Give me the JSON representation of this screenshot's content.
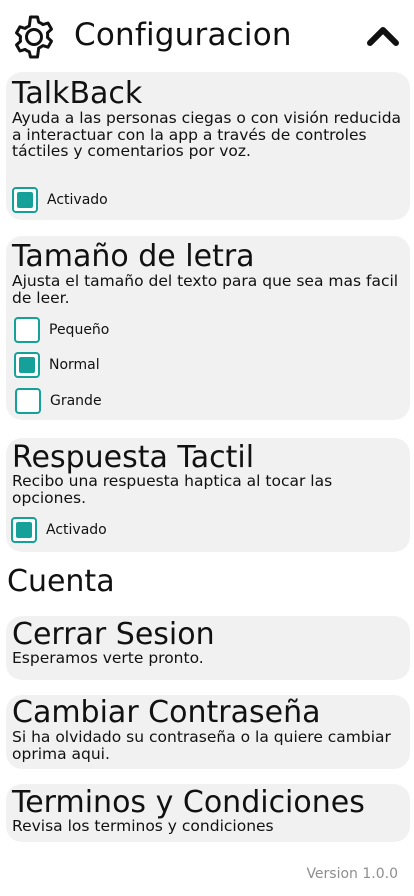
{
  "header": {
    "title": "Configuracion",
    "settings_icon": "gear-icon",
    "collapse_icon": "chevron-up-icon"
  },
  "talkback": {
    "title": "TalkBack",
    "description": "Ayuda a las personas ciegas o con visión reducida a interactuar con la app a través de controles táctiles y comentarios por voz.",
    "option": {
      "label": "Activado",
      "checked": true
    }
  },
  "font_size": {
    "title": "Tamaño de letra",
    "description": "Ajusta el tamaño del texto para que sea mas facil de leer.",
    "options": [
      {
        "label": "Pequeño",
        "checked": false
      },
      {
        "label": "Normal",
        "checked": true
      },
      {
        "label": "Grande",
        "checked": false
      }
    ]
  },
  "haptic": {
    "title": "Respuesta Tactil",
    "description": "Recibo una respuesta haptica al tocar las opciones.",
    "option": {
      "label": "Activado",
      "checked": true
    }
  },
  "account": {
    "section_title": "Cuenta",
    "logout": {
      "title": "Cerrar Sesion",
      "description": "Esperamos verte pronto."
    },
    "change_password": {
      "title": "Cambiar Contraseña",
      "description": "Si ha olvidado su contraseña o la quiere cambiar oprima aqui."
    },
    "terms": {
      "title": "Terminos y Condiciones",
      "description": "Revisa los terminos y condiciones"
    }
  },
  "footer": {
    "version": "Version 1.0.0"
  },
  "colors": {
    "accent": "#16a09a",
    "card": "#f1f1f1",
    "muted": "#8e8e8e"
  }
}
